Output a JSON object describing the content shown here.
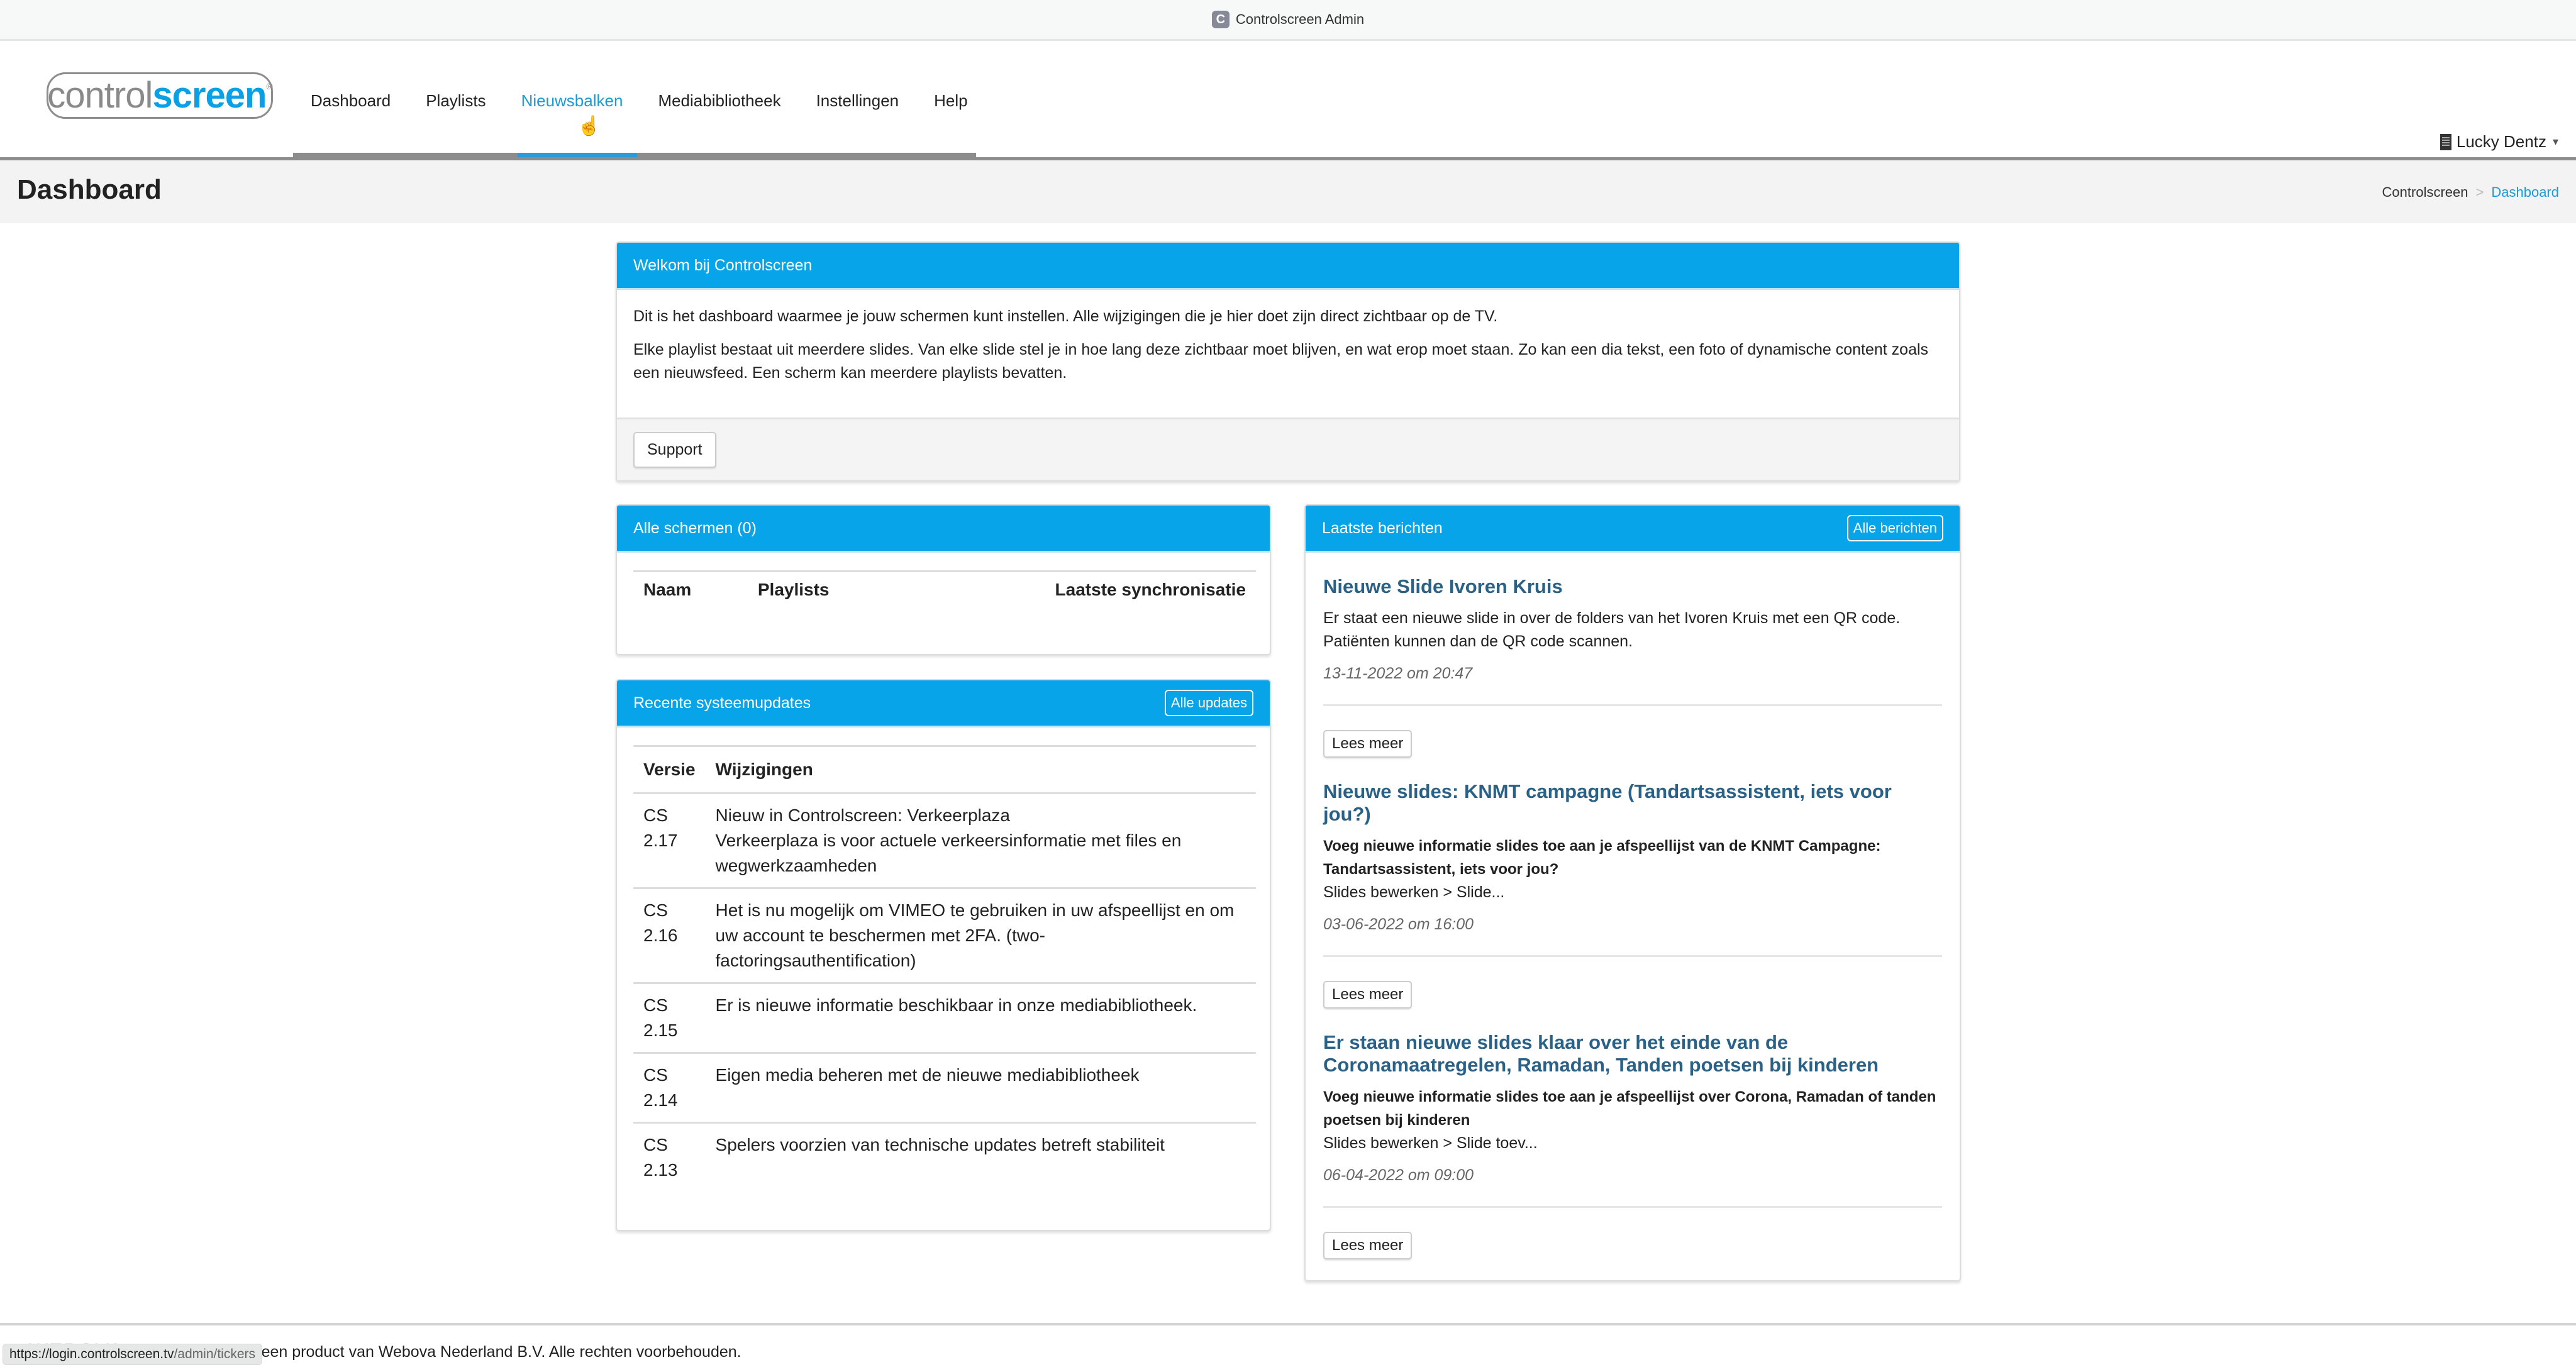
{
  "browser": {
    "favicon_letter": "C",
    "title": "Controlscreen Admin"
  },
  "logo": {
    "part1": "control",
    "part2": "screen",
    "reg": "®"
  },
  "nav": {
    "items": [
      {
        "label": "Dashboard"
      },
      {
        "label": "Playlists"
      },
      {
        "label": "Nieuwsbalken"
      },
      {
        "label": "Mediabibliotheek"
      },
      {
        "label": "Instellingen"
      },
      {
        "label": "Help"
      }
    ],
    "hovered": "Nieuwsbalken"
  },
  "user": {
    "name": "Lucky Dentz",
    "icon": "building-icon",
    "caret": "▾"
  },
  "page": {
    "title": "Dashboard",
    "breadcrumb": [
      "Controlscreen",
      "Dashboard"
    ],
    "breadcrumb_sep": ">"
  },
  "welcome": {
    "title": "Welkom bij Controlscreen",
    "para1": "Dit is het dashboard waarmee je jouw schermen kunt instellen. Alle wijzigingen die je hier doet zijn direct zichtbaar op de TV.",
    "para2": "Elke playlist bestaat uit meerdere slides. Van elke slide stel je in hoe lang deze zichtbaar moet blijven, en wat erop moet staan. Zo kan een dia tekst, een foto of dynamische content zoals een nieuwsfeed. Een scherm kan meerdere playlists bevatten.",
    "support_label": "Support"
  },
  "screens": {
    "title": "Alle schermen (0)",
    "columns": [
      "Naam",
      "Playlists",
      "Laatste synchronisatie"
    ],
    "rows": []
  },
  "updates": {
    "title": "Recente systeemupdates",
    "all_label": "Alle updates",
    "columns": [
      "Versie",
      "Wijzigingen"
    ],
    "rows": [
      {
        "version": "CS 2.17",
        "changes": "Nieuw in Controlscreen: Verkeerplaza\nVerkeerplaza is voor actuele verkeersinformatie met files en wegwerkzaamheden"
      },
      {
        "version": "CS 2.16",
        "changes": "Het is nu mogelijk om VIMEO te gebruiken in uw afspeellijst en om uw account te beschermen met 2FA. (two-factoringsauthentification)"
      },
      {
        "version": "CS 2.15",
        "changes": "Er is nieuwe informatie beschikbaar in onze mediabibliotheek."
      },
      {
        "version": "CS 2.14",
        "changes": "Eigen media beheren met de nieuwe mediabibliotheek"
      },
      {
        "version": "CS 2.13",
        "changes": "Spelers voorzien van technische updates betreft stabiliteit"
      }
    ]
  },
  "news": {
    "title": "Laatste berichten",
    "all_label": "Alle berichten",
    "read_more": "Lees meer",
    "items": [
      {
        "title": "Nieuwe Slide Ivoren Kruis",
        "lead": "",
        "text": "Er staat een nieuwe slide in over de folders van het Ivoren Kruis met een QR code. Patiënten kunnen dan de QR code scannen.",
        "date": "13-11-2022 om 20:47"
      },
      {
        "title": "Nieuwe slides: KNMT campagne (Tandartsassistent, iets voor jou?)",
        "lead": "Voeg nieuwe informatie slides toe aan je afspeellijst van de KNMT Campagne: Tandartsassistent, iets voor jou?",
        "text": "Slides bewerken > Slide...",
        "date": "03-06-2022 om 16:00"
      },
      {
        "title": "Er staan nieuwe slides klaar over het einde van de Coronamaatregelen, Ramadan, Tanden poetsen bij kinderen",
        "lead": "Voeg nieuwe informatie slides toe aan je afspeellijst over Corona, Ramadan of tanden poetsen bij kinderen",
        "text": "Slides bewerken > Slide toev...",
        "date": "06-04-2022 om 09:00"
      }
    ]
  },
  "footer": {
    "brand": "WEBOVA",
    "text": "Controlscreen is een product van Webova Nederland B.V. Alle rechten voorbehouden."
  },
  "status_bar": {
    "url_host": "https://login.controlscreen.tv",
    "url_path": "/admin/tickers"
  },
  "colors": {
    "accent": "#07a4e9",
    "link_title": "#2a6187",
    "nav_active": "#1a9bd7"
  }
}
